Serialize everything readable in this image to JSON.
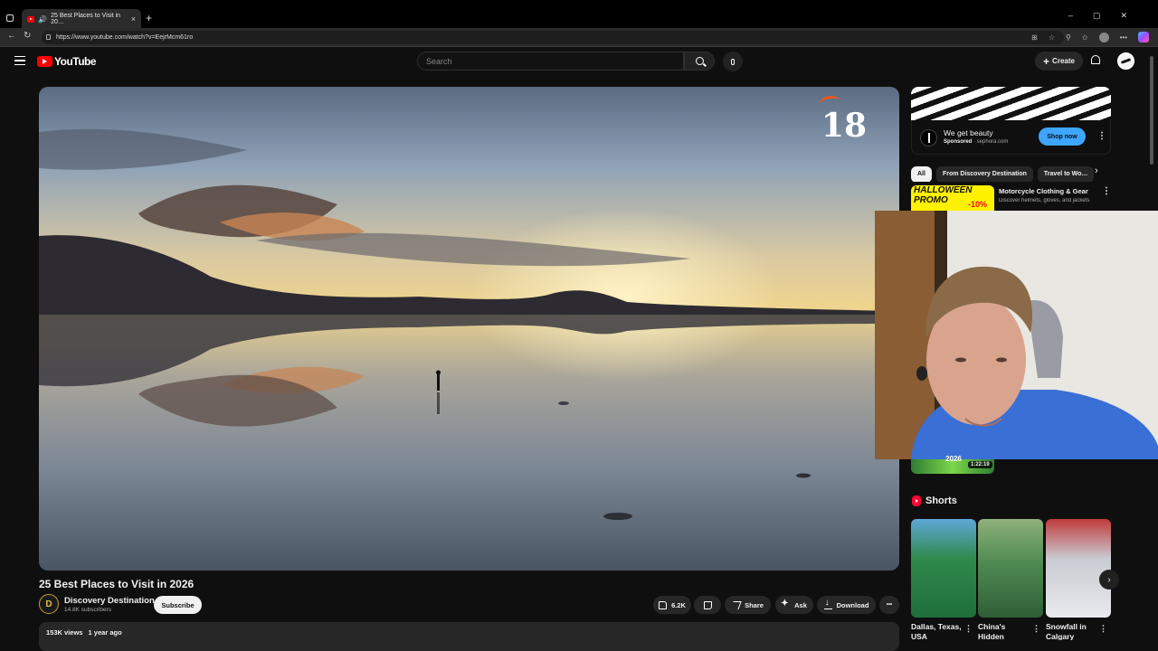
{
  "browser": {
    "tab_title": "25 Best Places to Visit in 20…",
    "tab_close": "×",
    "new_tab": "+",
    "url": "https://www.youtube.com/watch?v=EejrMcm61ro",
    "window_controls": [
      "–",
      "▢",
      "✕"
    ]
  },
  "youtube": {
    "logo_text": "YouTube",
    "search_placeholder": "Search",
    "create_label": "Create",
    "create_icon": "+"
  },
  "video": {
    "title": "25 Best Places to Visit in 2026",
    "age_badge": "18",
    "channel_initial": "D",
    "channel_name": "Discovery Destination",
    "subscribers": "14.8K subscribers",
    "subscribe_label": "Subscribe",
    "likes": "6.2K",
    "share_label": "Share",
    "ask_label": "Ask",
    "download_label": "Download",
    "more_label": "•••",
    "views": "153K views",
    "published": "1 year ago"
  },
  "sidebar": {
    "ad": {
      "title": "We get beauty",
      "sponsored": "Sponsored",
      "domain": "· sephora.com",
      "cta": "Shop now"
    },
    "chips": [
      "All",
      "From Discovery Destination",
      "Travel to Wo…"
    ],
    "recommended": [
      {
        "title": "Motorcycle Clothing & Gear",
        "desc": "Discover helmets, gloves, and jackets",
        "thumb_line1": "HALLOWEEN",
        "thumb_line2": "PROMO",
        "thumb_pct": "-10%"
      },
      {
        "partial_text": "2026",
        "duration": "1:22:19"
      }
    ],
    "shorts_header": "Shorts",
    "shorts": [
      {
        "title": "Dallas, Texas, USA",
        "color": "#1f6e3a"
      },
      {
        "title": "China's Hidden",
        "color": "#3d7a45"
      },
      {
        "title": "Snowfall in Calgary",
        "color": "#b7b9c2"
      }
    ],
    "next_arrow": "›"
  },
  "colors": {
    "brand_red": "#ff0000",
    "accent_blue": "#3ea6ff",
    "background": "#0f0f0f"
  }
}
